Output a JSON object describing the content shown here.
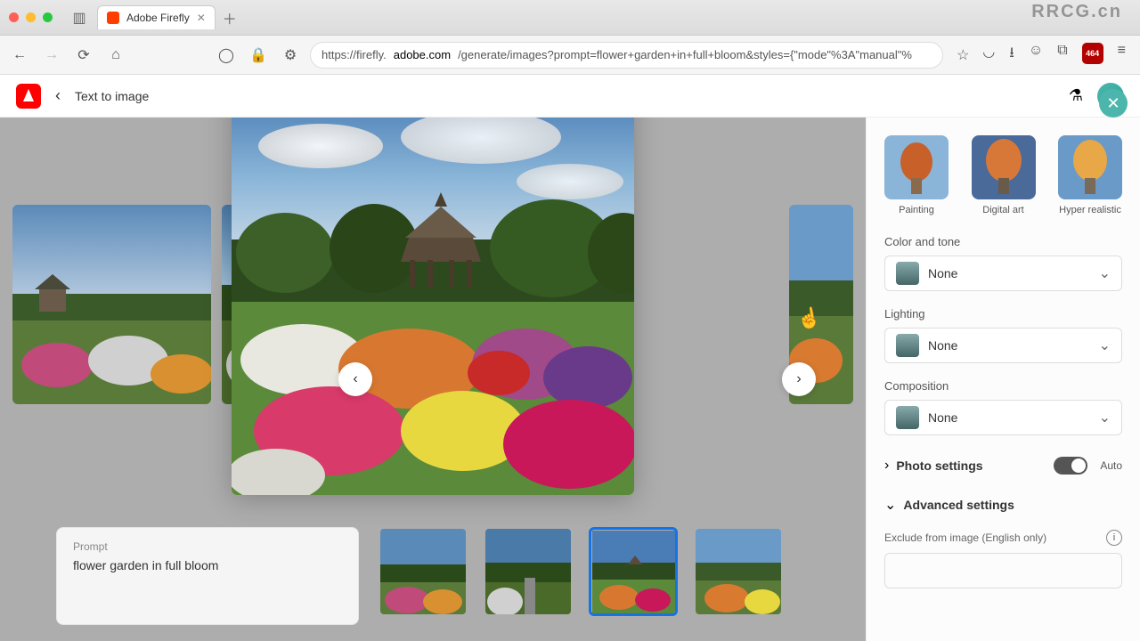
{
  "browser_tab": {
    "title": "Adobe Firefly"
  },
  "url": {
    "prefix": "https://firefly.",
    "domain": "adobe.com",
    "path": "/generate/images?prompt=flower+garden+in+full+bloom&styles={\"mode\"%3A\"manual\"%"
  },
  "toolbar_badge": "464",
  "app_header": {
    "title": "Text to image"
  },
  "prompt": {
    "label": "Prompt",
    "text": "flower garden in full bloom"
  },
  "styles": [
    {
      "label": "Painting"
    },
    {
      "label": "Digital art"
    },
    {
      "label": "Hyper realistic"
    }
  ],
  "controls": {
    "color_tone": {
      "label": "Color and tone",
      "value": "None"
    },
    "lighting": {
      "label": "Lighting",
      "value": "None"
    },
    "composition": {
      "label": "Composition",
      "value": "None"
    }
  },
  "photo_settings": {
    "label": "Photo settings",
    "auto_label": "Auto"
  },
  "advanced": {
    "label": "Advanced settings"
  },
  "exclude": {
    "label": "Exclude from image (English only)"
  },
  "thumbnails_selected_index": 2,
  "watermark_top": "RRCG.cn"
}
